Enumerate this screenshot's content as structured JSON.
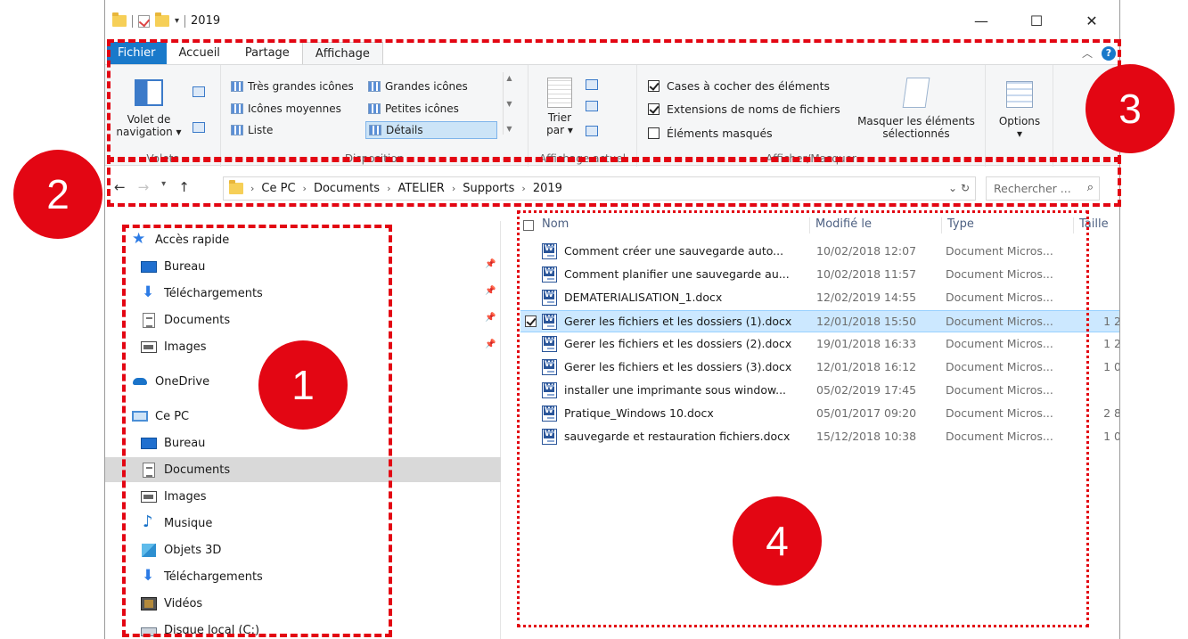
{
  "window": {
    "title": "2019",
    "controls": {
      "minimize": "—",
      "maximize": "☐",
      "close": "✕"
    }
  },
  "ribbon_tabs": [
    {
      "label": "Fichier"
    },
    {
      "label": "Accueil"
    },
    {
      "label": "Partage"
    },
    {
      "label": "Affichage",
      "active": true
    }
  ],
  "ribbon": {
    "volets": {
      "group_label": "Volets",
      "nav_pane_label_1": "Volet de",
      "nav_pane_label_2": "navigation ▾"
    },
    "disposition": {
      "group_label": "Disposition",
      "items": [
        "Très grandes icônes",
        "Grandes icônes",
        "Icônes moyennes",
        "Petites icônes",
        "Liste",
        "Détails"
      ],
      "selected": "Détails"
    },
    "affichage_actuel": {
      "group_label": "Affichage actuel",
      "sort_label_1": "Trier",
      "sort_label_2": "par ▾"
    },
    "afficher_masquer": {
      "group_label": "Afficher/Masquer",
      "checkboxes": [
        {
          "label": "Cases à cocher des éléments",
          "checked": true
        },
        {
          "label": "Extensions de noms de fichiers",
          "checked": true
        },
        {
          "label": "Éléments masqués",
          "checked": false
        }
      ],
      "hide_selected_label_1": "Masquer les éléments",
      "hide_selected_label_2": "sélectionnés"
    },
    "options": {
      "label": "Options",
      "arrow": "▾"
    }
  },
  "address": {
    "breadcrumbs": [
      "Ce PC",
      "Documents",
      "ATELIER",
      "Supports",
      "2019"
    ],
    "search_placeholder": "Rechercher ..."
  },
  "nav_pane": [
    {
      "label": "Accès rapide",
      "icon": "star-icon",
      "indent": 0
    },
    {
      "label": "Bureau",
      "icon": "desktop-icon",
      "indent": 1,
      "pinned": true
    },
    {
      "label": "Téléchargements",
      "icon": "download-icon",
      "indent": 1,
      "pinned": true
    },
    {
      "label": "Documents",
      "icon": "document-icon",
      "indent": 1,
      "pinned": true
    },
    {
      "label": "Images",
      "icon": "image-icon",
      "indent": 1,
      "pinned": true
    },
    {
      "label": "OneDrive",
      "icon": "cloud-icon",
      "indent": 0
    },
    {
      "label": "Ce PC",
      "icon": "computer-icon",
      "indent": 0
    },
    {
      "label": "Bureau",
      "icon": "desktop-icon",
      "indent": 1
    },
    {
      "label": "Documents",
      "icon": "document-icon",
      "indent": 1,
      "selected": true
    },
    {
      "label": "Images",
      "icon": "image-icon",
      "indent": 1
    },
    {
      "label": "Musique",
      "icon": "music-icon",
      "indent": 1
    },
    {
      "label": "Objets 3D",
      "icon": "cube-icon",
      "indent": 1
    },
    {
      "label": "Téléchargements",
      "icon": "download-icon",
      "indent": 1
    },
    {
      "label": "Vidéos",
      "icon": "video-icon",
      "indent": 1
    },
    {
      "label": "Disque local (C:)",
      "icon": "disk-icon",
      "indent": 1
    }
  ],
  "file_list": {
    "columns": {
      "name": "Nom",
      "modified": "Modifié le",
      "type": "Type",
      "size": "Taille"
    },
    "rows": [
      {
        "name": "Comment créer une sauvegarde auto...",
        "modified": "10/02/2018 12:07",
        "type": "Document Micros...",
        "size": ""
      },
      {
        "name": "Comment planifier une sauvegarde au...",
        "modified": "10/02/2018 11:57",
        "type": "Document Micros...",
        "size": ""
      },
      {
        "name": "DEMATERIALISATION_1.docx",
        "modified": "12/02/2019 14:55",
        "type": "Document Micros...",
        "size": ""
      },
      {
        "name": "Gerer les fichiers et les dossiers (1).docx",
        "modified": "12/01/2018 15:50",
        "type": "Document Micros...",
        "size": "1 2",
        "selected": true
      },
      {
        "name": "Gerer les fichiers et les dossiers (2).docx",
        "modified": "19/01/2018 16:33",
        "type": "Document Micros...",
        "size": "1 2"
      },
      {
        "name": "Gerer les fichiers et les dossiers (3).docx",
        "modified": "12/01/2018 16:12",
        "type": "Document Micros...",
        "size": "1 0"
      },
      {
        "name": "installer une imprimante sous window...",
        "modified": "05/02/2019 17:45",
        "type": "Document Micros...",
        "size": ""
      },
      {
        "name": "Pratique_Windows 10.docx",
        "modified": "05/01/2017 09:20",
        "type": "Document Micros...",
        "size": "2 8"
      },
      {
        "name": "sauvegarde et restauration fichiers.docx",
        "modified": "15/12/2018 10:38",
        "type": "Document Micros...",
        "size": "1 0"
      }
    ]
  },
  "annotations": [
    "1",
    "2",
    "3",
    "4"
  ],
  "colors": {
    "accent": "#1979ca",
    "annotation_red": "#e30613",
    "selection": "#cce8ff"
  }
}
